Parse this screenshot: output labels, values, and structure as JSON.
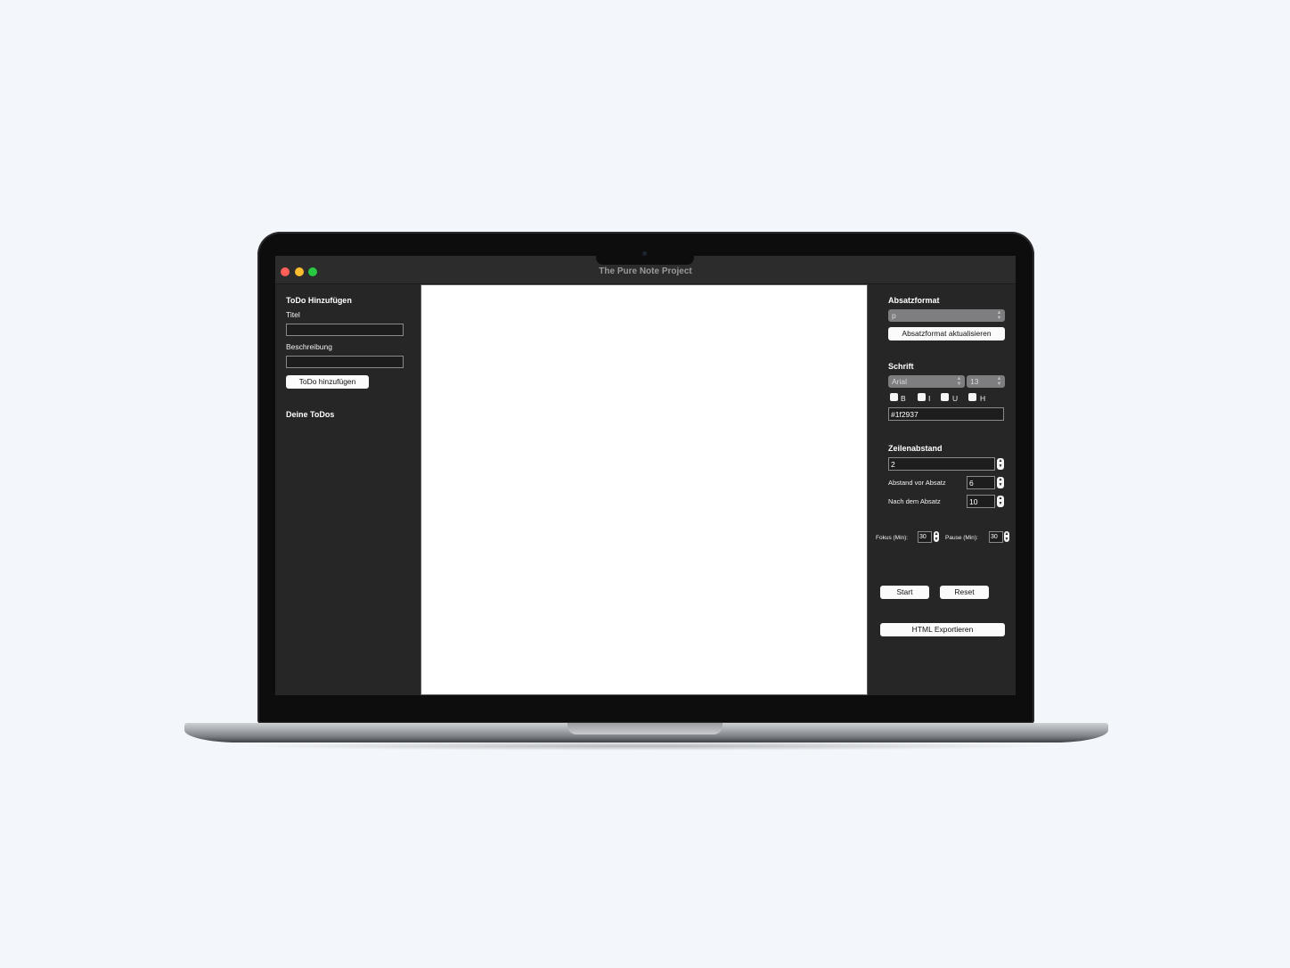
{
  "window": {
    "title": "The Pure Note Project"
  },
  "todo": {
    "heading": "ToDo Hinzufügen",
    "title_label": "Titel",
    "title_value": "",
    "description_label": "Beschreibung",
    "description_value": "",
    "add_button": "ToDo hinzufügen",
    "list_heading": "Deine ToDos"
  },
  "paragraph": {
    "heading": "Absatzformat",
    "format_value": "p",
    "update_button": "Absatzformat aktualisieren"
  },
  "font": {
    "heading": "Schrift",
    "family_value": "Arial",
    "size_value": "13",
    "bold_label": "B",
    "italic_label": "I",
    "underline_label": "U",
    "highlight_label": "H",
    "color_value": "#1f2937"
  },
  "spacing": {
    "heading": "Zeilenabstand",
    "line_height_value": "2",
    "before_label": "Abstand vor Absatz",
    "before_value": "6",
    "after_label": "Nach dem Absatz",
    "after_value": "10"
  },
  "timer": {
    "focus_label": "Fokus (Min):",
    "focus_value": "30",
    "pause_label": "Pause (Min):",
    "pause_value": "30",
    "start_button": "Start",
    "reset_button": "Reset"
  },
  "export": {
    "html_button": "HTML Exportieren"
  },
  "colors": {
    "panel_bg": "#262627",
    "editor_bg": "#ffffff",
    "traffic_red": "#fe5f57",
    "traffic_yellow": "#febc2e",
    "traffic_green": "#28c840"
  }
}
